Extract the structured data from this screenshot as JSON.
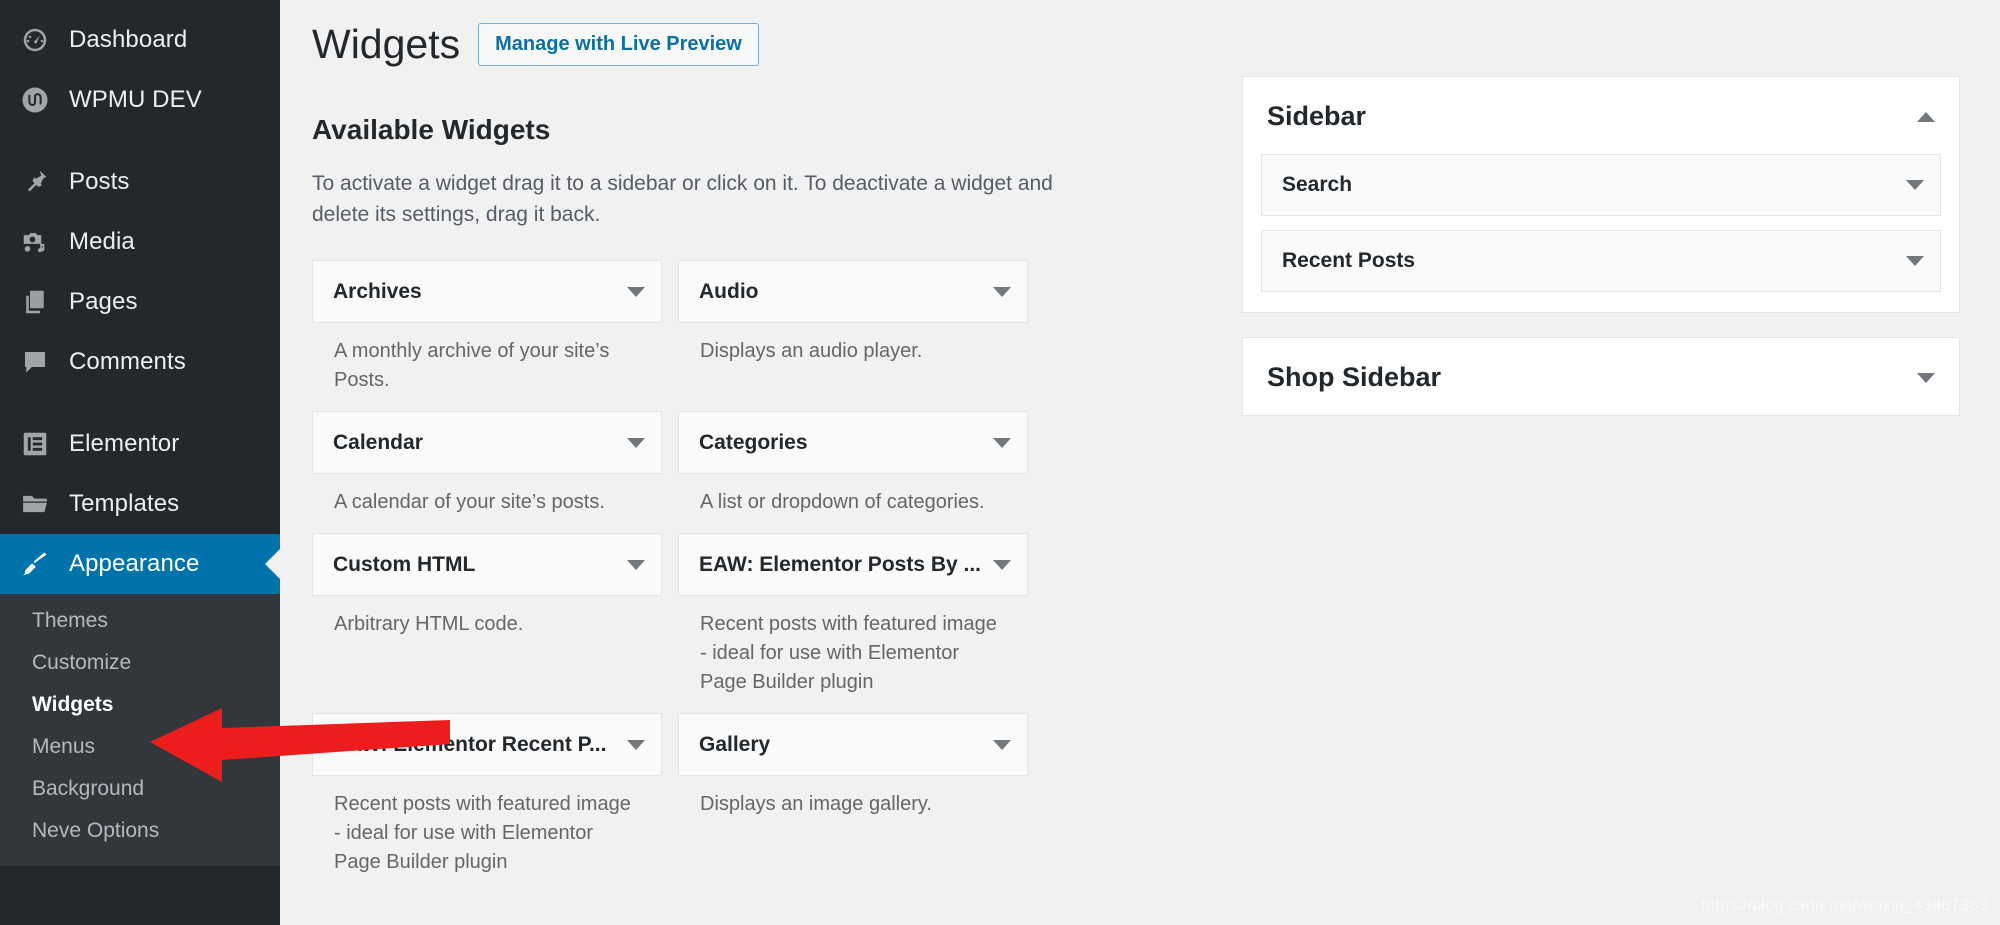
{
  "admin_menu": {
    "items": [
      {
        "label": "Dashboard",
        "icon": "dashboard-icon"
      },
      {
        "label": "WPMU DEV",
        "icon": "wpmudev-icon"
      },
      {
        "separator_after": true
      },
      {
        "label": "Posts",
        "icon": "pin-icon"
      },
      {
        "label": "Media",
        "icon": "media-icon"
      },
      {
        "label": "Pages",
        "icon": "pages-icon"
      },
      {
        "label": "Comments",
        "icon": "comments-icon"
      },
      {
        "separator_after": true
      },
      {
        "label": "Elementor",
        "icon": "elementor-icon"
      },
      {
        "label": "Templates",
        "icon": "folder-icon"
      },
      {
        "label": "Appearance",
        "icon": "paintbrush-icon",
        "active": true
      }
    ],
    "submenu": [
      {
        "label": "Themes"
      },
      {
        "label": "Customize"
      },
      {
        "label": "Widgets",
        "current": true
      },
      {
        "label": "Menus"
      },
      {
        "label": "Background"
      },
      {
        "label": "Neve Options"
      }
    ],
    "active_color": "#0073aa",
    "background_color": "#23282d",
    "submenu_background_color": "#32373c"
  },
  "header": {
    "title": "Widgets",
    "live_preview_button": "Manage with Live Preview"
  },
  "available": {
    "heading": "Available Widgets",
    "description": "To activate a widget drag it to a sidebar or click on it. To deactivate a widget and delete its settings, drag it back.",
    "widgets": [
      {
        "title": "Archives",
        "description": "A monthly archive of your site’s Posts."
      },
      {
        "title": "Audio",
        "description": "Displays an audio player."
      },
      {
        "title": "Calendar",
        "description": "A calendar of your site’s posts."
      },
      {
        "title": "Categories",
        "description": "A list or dropdown of categories."
      },
      {
        "title": "Custom HTML",
        "description": "Arbitrary HTML code."
      },
      {
        "title": "EAW: Elementor Posts By ...",
        "description": "Recent posts with featured image - ideal for use with Elementor Page Builder plugin"
      },
      {
        "title": "EAW: Elementor Recent P...",
        "description": "Recent posts with featured image - ideal for use with Elementor Page Builder plugin"
      },
      {
        "title": "Gallery",
        "description": "Displays an image gallery."
      }
    ]
  },
  "sidebars": [
    {
      "title": "Sidebar",
      "expanded": true,
      "toggle_icon": "chevron-up-icon",
      "widgets": [
        {
          "title": "Search",
          "toggle_icon": "chevron-down-icon"
        },
        {
          "title": "Recent Posts",
          "toggle_icon": "chevron-down-icon"
        }
      ]
    },
    {
      "title": "Shop Sidebar",
      "expanded": false,
      "toggle_icon": "chevron-down-icon",
      "widgets": []
    }
  ],
  "annotation": {
    "type": "arrow",
    "color": "#ee1d1d",
    "points_to": "Widgets"
  },
  "watermark": "https://blog.csdn.net/weixin_43887383"
}
